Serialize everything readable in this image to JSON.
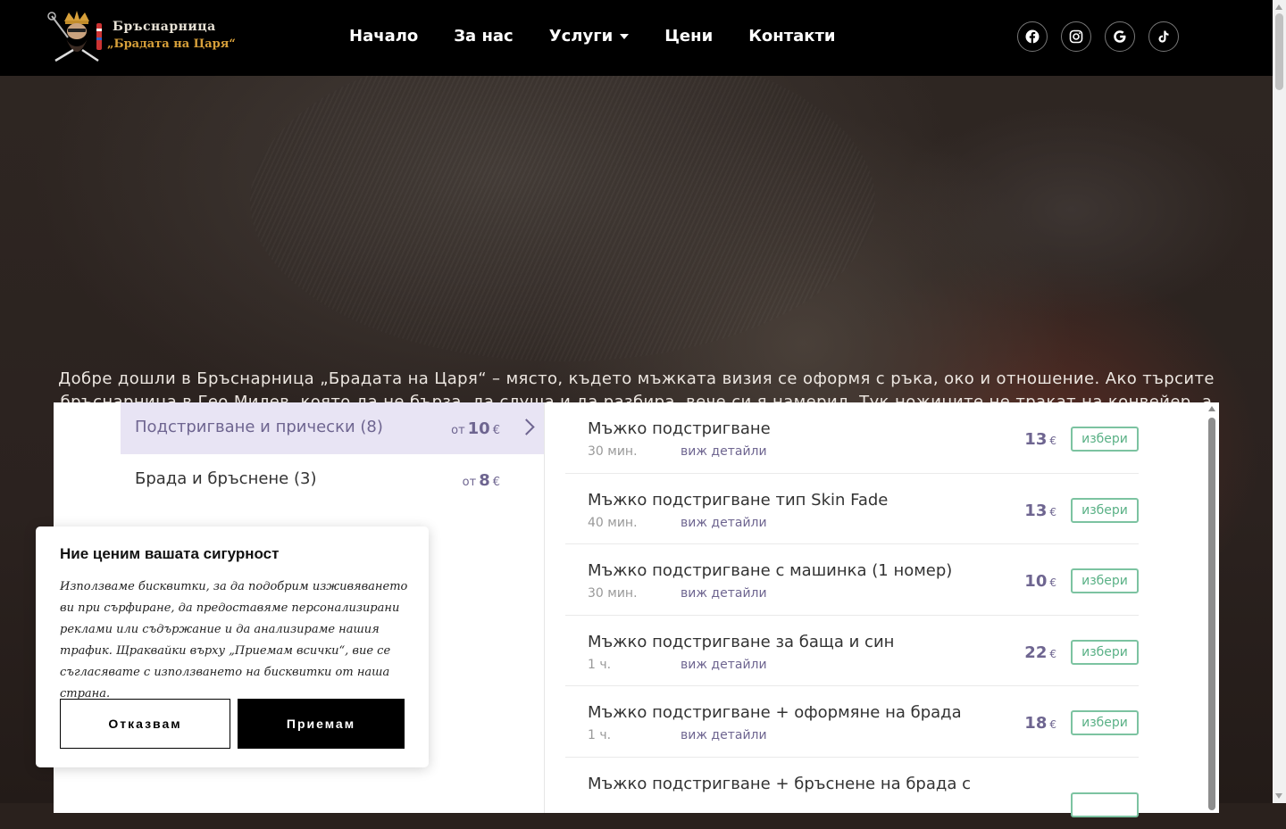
{
  "brand": {
    "line1": "Бръснарница",
    "line2": "„Брадата на Царя“"
  },
  "nav": {
    "items": [
      {
        "label": "Начало"
      },
      {
        "label": "За нас"
      },
      {
        "label": "Услуги",
        "has_dropdown": true
      },
      {
        "label": "Цени"
      },
      {
        "label": "Контакти"
      }
    ]
  },
  "social": [
    "facebook-icon",
    "instagram-icon",
    "google-icon",
    "tiktok-icon"
  ],
  "hero": {
    "intro": "Добре дошли в Бръснарница „Брадата на Царя“ – място, където мъжката визия се оформя с ръка, око и отношение. Ако търсите бръснарница в Гео Милев, която да не бърза, да слуша и да разбира, вече си я намерил. Тук ножиците не тракат на конвейер, а работят спокойно, сякаш сме седнали на кафе и говорим за важните неща."
  },
  "booking": {
    "categories": [
      {
        "name": "Подстригване и прически (8)",
        "price_prefix": "от",
        "price": "10",
        "currency": "€",
        "active": true
      },
      {
        "name": "Брада и бръснене (3)",
        "price_prefix": "от",
        "price": "8",
        "currency": "€",
        "active": false
      }
    ],
    "services": [
      {
        "name": "Мъжко подстригване",
        "duration": "30 мин.",
        "details": "виж детайли",
        "price": "13",
        "currency": "€",
        "select": "избери"
      },
      {
        "name": "Мъжко подстригване тип Skin Fade",
        "duration": "40 мин.",
        "details": "виж детайли",
        "price": "13",
        "currency": "€",
        "select": "избери"
      },
      {
        "name": "Мъжко подстригване с машинка (1 номер)",
        "duration": "30 мин.",
        "details": "виж детайли",
        "price": "10",
        "currency": "€",
        "select": "избери"
      },
      {
        "name": "Мъжко подстригване за баща и син",
        "duration": "1 ч.",
        "details": "виж детайли",
        "price": "22",
        "currency": "€",
        "select": "избери"
      },
      {
        "name": "Мъжко подстригване + оформяне на брада",
        "duration": "1 ч.",
        "details": "виж детайли",
        "price": "18",
        "currency": "€",
        "select": "избери"
      },
      {
        "name": "Мъжко подстригване + бръснене на брада с",
        "duration": "",
        "details": "",
        "price": "",
        "currency": "",
        "select": ""
      }
    ]
  },
  "cookie": {
    "title": "Ние ценим вашата сигурност",
    "text": "Използваме бисквитки, за да подобрим изживяването ви при сърфиране, да предоставяме персонализирани реклами или съдържание и да анализираме нашия трафик. Щраквайки върху „Приемам всички“, вие се съгласявате с използването на бисквитки от наша страна.",
    "reject": "Отказвам",
    "accept": "Приемам"
  },
  "colors": {
    "accent": "#6e6590",
    "select_green": "#5ab186",
    "active_bg": "#e8e4f4",
    "header_bg": "#000000"
  }
}
